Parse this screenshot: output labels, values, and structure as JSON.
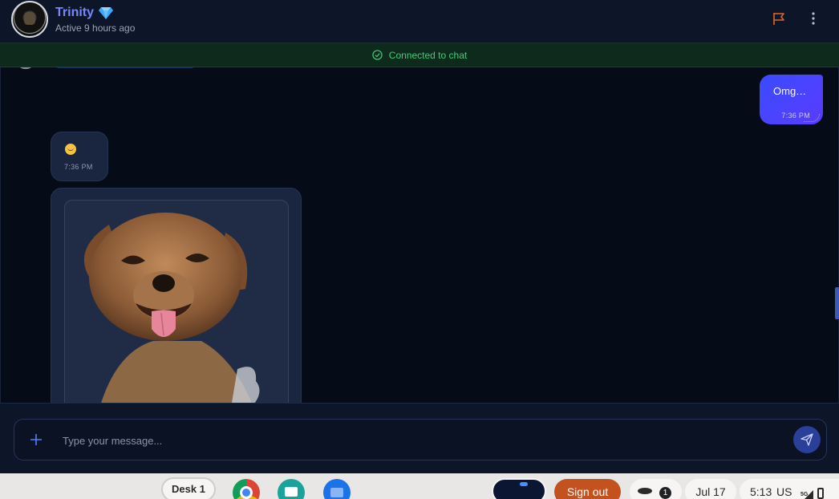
{
  "header": {
    "contact_name": "Trinity",
    "status": "Active 9 hours ago",
    "badge_icon": "diamond-icon",
    "accent_color": "#7a86ff",
    "actions": [
      "flag-icon",
      "more-vert-icon"
    ]
  },
  "banner": {
    "text": "Connected to chat",
    "color": "#3ecf74"
  },
  "messages": [
    {
      "direction": "out",
      "text": "Omg…",
      "time": "7:36 PM"
    },
    {
      "direction": "in",
      "emoji": "pleading-face",
      "time": "7:36 PM"
    },
    {
      "direction": "in",
      "type": "image",
      "description_icon": "dog-sticker-image"
    }
  ],
  "composer": {
    "placeholder": "Type your message...",
    "attach_icon": "plus-icon",
    "send_icon": "send-icon"
  },
  "shelf": {
    "desk_label": "Desk 1",
    "apps": [
      "chrome-icon",
      "app-icon",
      "files-icon"
    ],
    "sign_out_label": "Sign out",
    "notification_count": "1",
    "date": "Jul 17",
    "time": "5:13",
    "input_method": "US",
    "network": "5G"
  }
}
